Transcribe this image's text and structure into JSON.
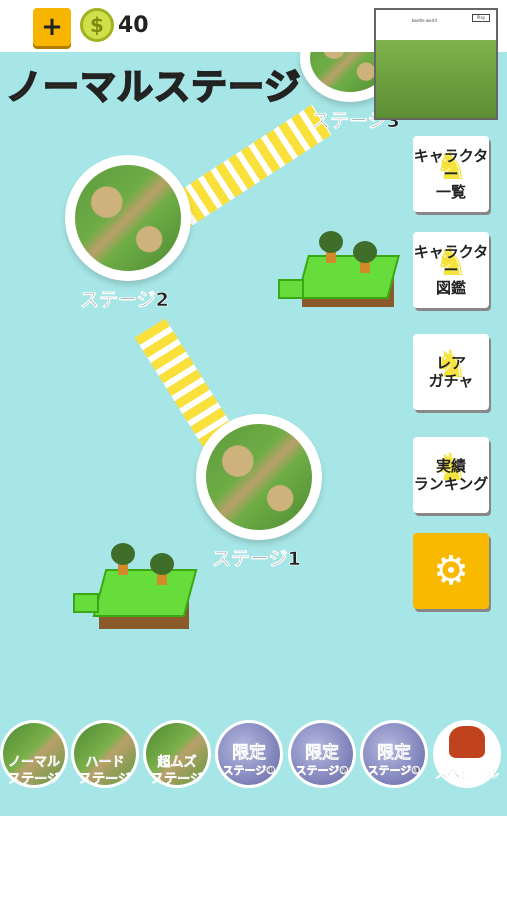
{
  "header": {
    "plus_label": "+",
    "coin_symbol": "$",
    "coin_count": "40"
  },
  "map": {
    "title": "ノーマルステージ",
    "stages": [
      {
        "label": "ステージ1"
      },
      {
        "label": "ステージ2"
      },
      {
        "label": "ステージ3"
      }
    ]
  },
  "minimap": {
    "title": "beetle world",
    "button": "Play"
  },
  "side_buttons": [
    {
      "label": "キャラクター\n一覧",
      "icon": "beetle-icon"
    },
    {
      "label": "キャラクター\n図鑑",
      "icon": "beetle-icon"
    },
    {
      "label": "レア\nガチャ",
      "icon": "beetle-icon"
    },
    {
      "label": "実績\nランキング",
      "icon": "beetle-icon"
    }
  ],
  "settings": {
    "icon": "gear-icon",
    "glyph": "⚙"
  },
  "modes": [
    {
      "label": "ノーマル\nステージ",
      "style": "grass"
    },
    {
      "label": "ハード\nステージ",
      "style": "grass"
    },
    {
      "label": "超ムズ\nステージ",
      "style": "grass"
    },
    {
      "title": "限定",
      "sub": "ステージ①",
      "style": "rock"
    },
    {
      "title": "限定",
      "sub": "ステージ②",
      "style": "rock"
    },
    {
      "title": "限定",
      "sub": "ステージ③",
      "style": "rock"
    },
    {
      "label": "スペシャル",
      "style": "special"
    }
  ],
  "colors": {
    "water": "#a7e6e6",
    "accent": "#f9b900",
    "title": "#f1a200",
    "path_yellow": "#f9e03a",
    "grass": "#66dd3a"
  }
}
